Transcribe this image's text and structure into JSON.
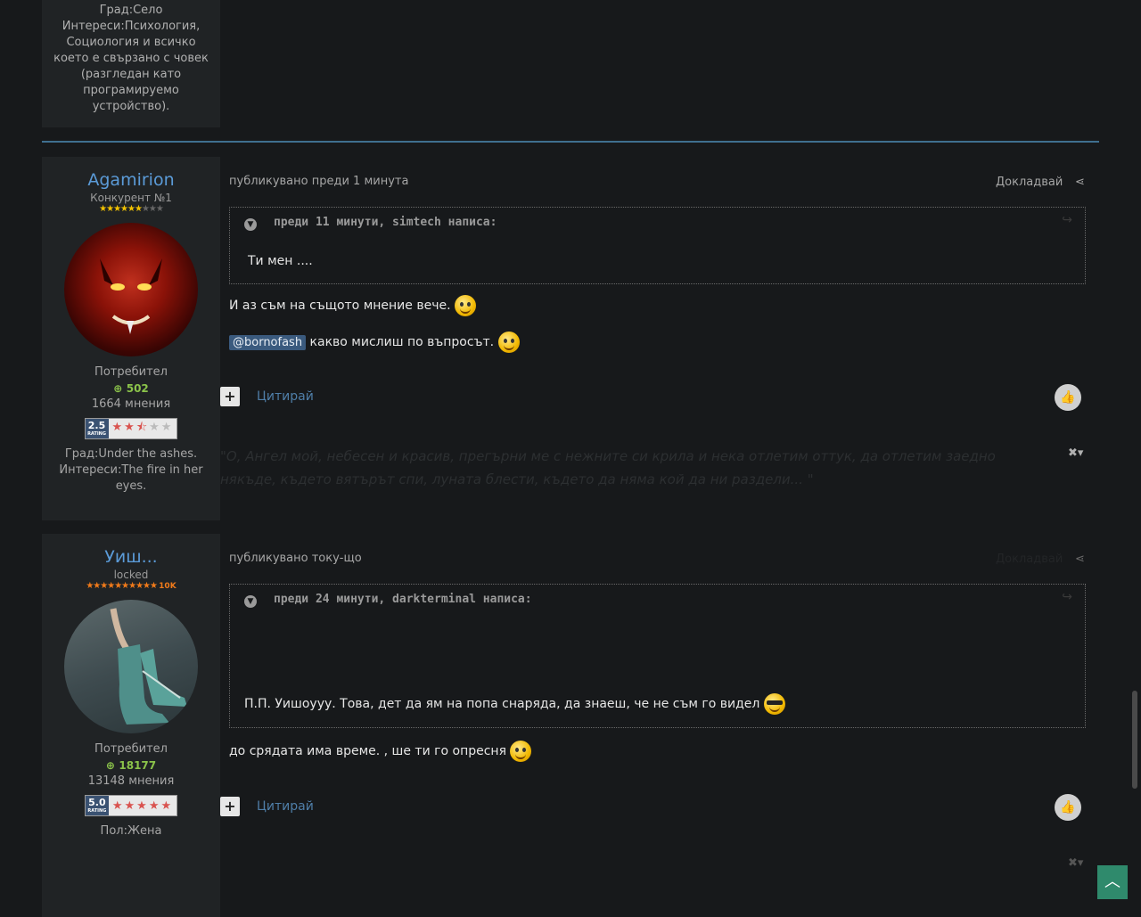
{
  "prev_post": {
    "author_info_lines": [
      "Град:Село",
      "Интереси:Психология,",
      "Социология и всичко",
      "което е свързано с човек",
      "(разгледан като",
      "програмируемо",
      "устройство)."
    ]
  },
  "post1": {
    "author": {
      "name": "Agamirion",
      "rank": "Конкурент №1",
      "stars_filled": 6,
      "stars_total": 9,
      "group": "Потребител",
      "reputation": "502",
      "posts_count": "1664 мнения",
      "rating": {
        "value": "2.5",
        "stars": 2.5,
        "max": 5
      },
      "info_lines": [
        "Град:Under the ashes.",
        "Интереси:The fire in her",
        "eyes."
      ]
    },
    "timestamp": "публикувано преди 1 минута",
    "report_label": "Докладвай",
    "quote": {
      "header": "преди 11 минути, simtech написа:",
      "text": "Ти мен ...."
    },
    "paragraphs": [
      {
        "text": "И аз съм на същото мнение вече.",
        "emoji": "smile"
      },
      {
        "mention": "@bornofash",
        "text": "какво мислиш по въпросът.",
        "emoji": "smile"
      }
    ],
    "quote_button": "Цитирай",
    "signature": "\"О, Ангел мой, небесен и красив, прегърни ме с нежните си крила и нека отлетим оттук, да отлетим заедно някъде, където вятърът спи, луната блести, където да няма кой да ни раздели... \""
  },
  "post2": {
    "author": {
      "name": "Уиш...",
      "rank": "locked",
      "stars_filled": 10,
      "stars_total": 10,
      "stars_badge": "10K",
      "group": "Потребител",
      "reputation": "18177",
      "posts_count": "13148 мнения",
      "rating": {
        "value": "5.0",
        "stars": 5,
        "max": 5
      },
      "info_lines": [
        "Пол:Жена"
      ]
    },
    "timestamp": "публикувано току-що",
    "report_label": "Докладвай",
    "quote": {
      "header": "преди 24 минути, darkterminal написа:",
      "text": "П.П. Уишоууу. Това, дет да ям на попа снаряда, да знаеш, че не съм го видел"
    },
    "paragraphs": [
      {
        "text": "до срядата има време. , ше ти го опресня",
        "emoji": "smile"
      }
    ],
    "quote_button": "Цитирай"
  },
  "colors": {
    "background": "#17191b",
    "panel": "#202325",
    "accent": "#5b9bd8",
    "divider": "#3f6f8f",
    "scroll_top": "#2f8a6c"
  }
}
